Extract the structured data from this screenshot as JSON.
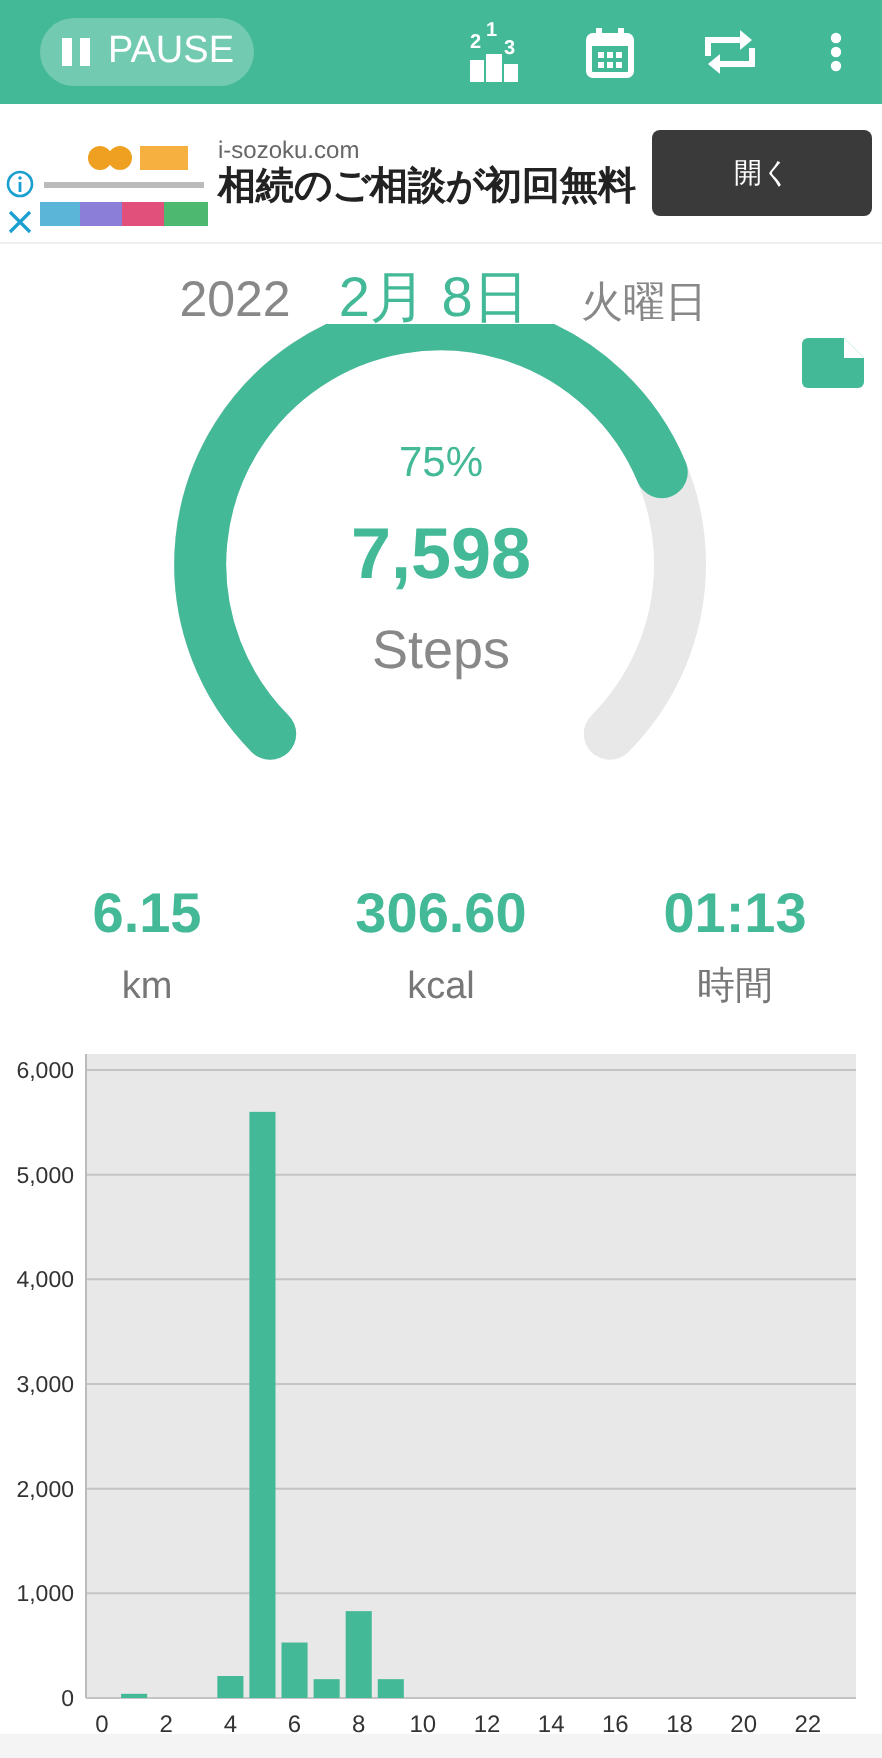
{
  "toolbar": {
    "pause_button": "PAUSE",
    "ranking_icon_digits": [
      "2",
      "1",
      "3"
    ]
  },
  "ad": {
    "kind": "picture",
    "domain": "i-sozoku.com",
    "headline": "相続のご相談が初回無料",
    "open_button": "開く"
  },
  "date": {
    "year": "2022",
    "month_day": "2月 8日",
    "weekday": "火曜日"
  },
  "gauge": {
    "percent": "75%",
    "steps": "7,598",
    "unit": "Steps"
  },
  "stats": [
    {
      "value": "6.15",
      "unit": "km"
    },
    {
      "value": "306.60",
      "unit": "kcal"
    },
    {
      "value": "01:13",
      "unit": "時間"
    }
  ],
  "chart_data": {
    "type": "bar",
    "x": [
      0,
      1,
      2,
      3,
      4,
      5,
      6,
      7,
      8,
      9,
      10,
      11,
      12,
      13,
      14,
      15,
      16,
      17,
      18,
      19,
      20,
      21,
      22,
      23
    ],
    "series": [
      {
        "color": "#43b997",
        "values": [
          0,
          40,
          0,
          0,
          210,
          5600,
          530,
          180,
          830,
          180,
          0,
          0,
          0,
          0,
          0,
          0,
          0,
          0,
          0,
          0,
          0,
          0,
          0,
          0
        ]
      }
    ],
    "xlim": [
      -0.5,
      23.5
    ],
    "grid": true,
    "xticks": [
      0,
      2,
      4,
      6,
      8,
      10,
      12,
      14,
      16,
      18,
      20,
      22
    ],
    "yticks": [
      {
        "value": 0,
        "label": "0"
      },
      {
        "value": 1000,
        "label": "1,000"
      },
      {
        "value": 2000,
        "label": "2,000"
      },
      {
        "value": 3000,
        "label": "3,000"
      },
      {
        "value": 4000,
        "label": "4,000"
      },
      {
        "value": 5000,
        "label": "5,000"
      },
      {
        "value": 6000,
        "label": "6,000"
      }
    ],
    "ylim": [
      0,
      6000
    ]
  }
}
